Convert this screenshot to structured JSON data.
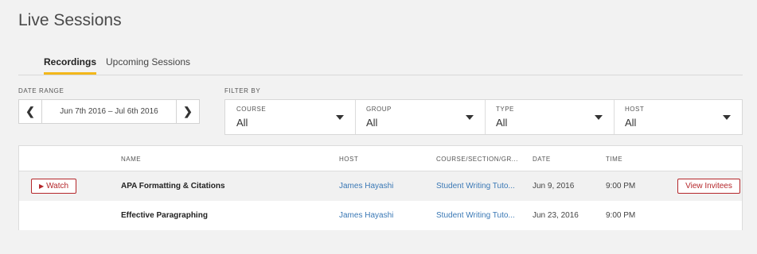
{
  "page": {
    "title": "Live Sessions"
  },
  "tabs": [
    {
      "label": "Recordings",
      "active": true
    },
    {
      "label": "Upcoming Sessions",
      "active": false
    }
  ],
  "date_range": {
    "label": "DATE RANGE",
    "value": "Jun 7th 2016 – Jul 6th 2016",
    "prev_icon": "chevron-left-icon",
    "next_icon": "chevron-right-icon"
  },
  "filter_by": {
    "label": "FILTER BY",
    "filters": [
      {
        "name": "COURSE",
        "value": "All"
      },
      {
        "name": "GROUP",
        "value": "All"
      },
      {
        "name": "TYPE",
        "value": "All"
      },
      {
        "name": "HOST",
        "value": "All"
      }
    ]
  },
  "table": {
    "columns": [
      "NAME",
      "HOST",
      "COURSE/SECTION/GR...",
      "DATE",
      "TIME"
    ],
    "rows": [
      {
        "watch_label": "Watch",
        "name": "APA Formatting & Citations",
        "host": "James Hayashi",
        "course": "Student Writing Tuto...",
        "date": "Jun 9, 2016",
        "time": "9:00 PM",
        "invitees_label": "View Invitees"
      },
      {
        "name": "Effective Paragraphing",
        "host": "James Hayashi",
        "course": "Student Writing Tuto...",
        "date": "Jun 23, 2016",
        "time": "9:00 PM"
      }
    ]
  },
  "colors": {
    "accent": "#f3b71b",
    "danger": "#b4262a",
    "link": "#3a78b5",
    "background": "#f2f2f2"
  }
}
